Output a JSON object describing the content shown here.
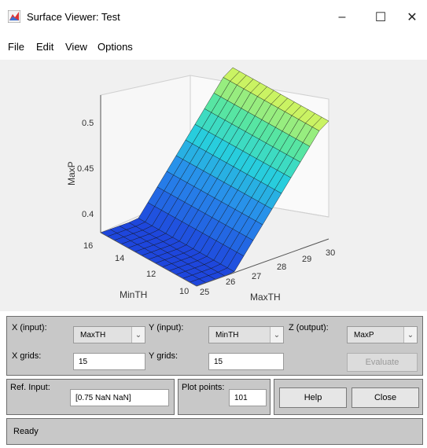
{
  "window": {
    "title": "Surface Viewer: Test",
    "minimize": "–",
    "maximize": "☐",
    "close": "✕"
  },
  "menu": [
    "File",
    "Edit",
    "View",
    "Options"
  ],
  "plot": {
    "z_label": "MaxP",
    "x_label": "MaxTH",
    "y_label": "MinTH",
    "z_ticks": [
      "0.5",
      "0.45",
      "0.4"
    ],
    "x_ticks": [
      "25",
      "26",
      "27",
      "28",
      "29",
      "30"
    ],
    "y_ticks": [
      "16",
      "14",
      "12",
      "10"
    ]
  },
  "controls": {
    "x_input_label": "X (input):",
    "x_input_value": "MaxTH",
    "y_input_label": "Y (input):",
    "y_input_value": "MinTH",
    "z_output_label": "Z (output):",
    "z_output_value": "MaxP",
    "x_grids_label": "X grids:",
    "x_grids_value": "15",
    "y_grids_label": "Y grids:",
    "y_grids_value": "15",
    "evaluate_label": "Evaluate",
    "ref_input_label": "Ref. Input:",
    "ref_input_value": "[0.75 NaN NaN]",
    "plot_points_label": "Plot points:",
    "plot_points_value": "101",
    "help_label": "Help",
    "close_label": "Close"
  },
  "status": "Ready"
}
